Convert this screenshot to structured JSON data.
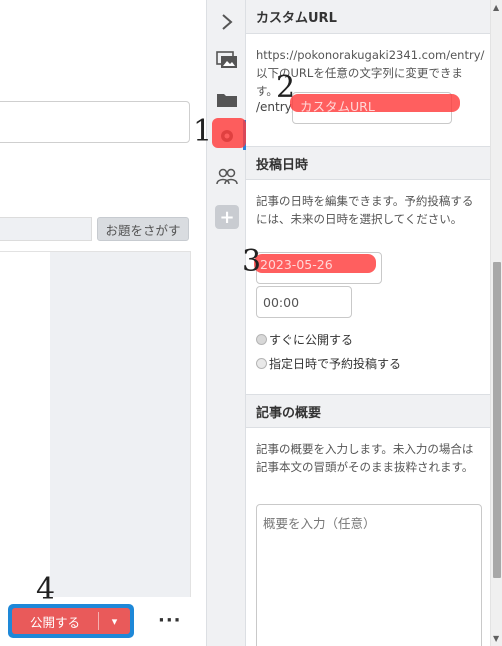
{
  "editor": {
    "topic_button_label": "お題をさがす",
    "publish_label": "公開する",
    "publish_dropdown_glyph": "▾",
    "more_label": "···"
  },
  "toolbar": {
    "collapse_glyph": "›",
    "plus_glyph": "+",
    "icons": [
      "chevron-right-icon",
      "image-icon",
      "folder-icon",
      "gear-icon",
      "users-icon",
      "plus-icon"
    ]
  },
  "custom_url": {
    "header": "カスタムURL",
    "description": "https://pokonorakugaki2341.com/entry/以下のURLを任意の文字列に変更できます。",
    "prefix": "/entry/",
    "placeholder": "カスタムURL"
  },
  "post_datetime": {
    "header": "投稿日時",
    "description": "記事の日時を編集できます。予約投稿するには、未来の日時を選択してください。",
    "date_value": "2023-05-26",
    "time_value": "00:00",
    "option_publish_now": "すぐに公開する",
    "option_schedule": "指定日時で予約投稿する"
  },
  "summary": {
    "header": "記事の概要",
    "description": "記事の概要を入力します。未入力の場合は記事本文の冒頭がそのまま抜粋されます。",
    "placeholder": "概要を入力（任意）"
  },
  "annotations": [
    "1",
    "2",
    "3",
    "4"
  ],
  "colors": {
    "accent_blue": "#1e88d8",
    "highlight_red": "#ff3c3c",
    "panel_header_bg": "#f0f1f3"
  }
}
